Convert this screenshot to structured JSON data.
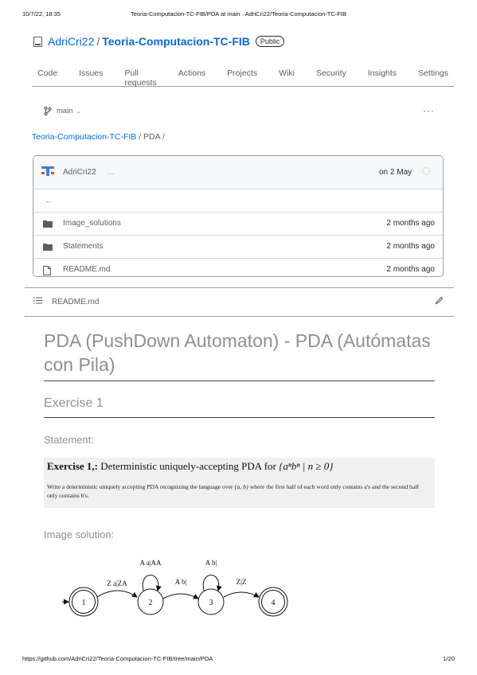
{
  "print": {
    "date": "10/7/22, 18:35",
    "title": "Teoria-Computacion-TC-FIB/PDA at main · AdriCri22/Teoria-Computacion-TC-FIB",
    "url": "https://github.com/AdriCri22/Teoria-Computacion-TC-FIB/tree/main/PDA",
    "page": "1/20"
  },
  "repo": {
    "owner": "AdriCri22",
    "separator": "/",
    "name": "Teoria-Computacion-TC-FIB",
    "visibility": "Public",
    "icon": "repo-icon"
  },
  "tabs": [
    {
      "label": "Code"
    },
    {
      "label": "Issues"
    },
    {
      "label": "Pull requests"
    },
    {
      "label": "Actions"
    },
    {
      "label": "Projects"
    },
    {
      "label": "Wiki"
    },
    {
      "label": "Security"
    },
    {
      "label": "Insights"
    },
    {
      "label": "Settings"
    }
  ],
  "branch": {
    "name": "main",
    "icon": "git-branch-icon",
    "more_icon": "kebab-icon"
  },
  "breadcrumb": {
    "repo_link": "Teoria-Computacion-TC-FIB",
    "rest": " / PDA /"
  },
  "commit": {
    "author": "AdriCri22",
    "ellipsis": "…",
    "date": "on 2 May"
  },
  "files": {
    "updir": "..",
    "rows": [
      {
        "name": "Image_solutions",
        "date": "2 months ago",
        "type": "folder"
      },
      {
        "name": "Statements",
        "date": "2 months ago",
        "type": "folder"
      },
      {
        "name": "README.md",
        "date": "2 months ago",
        "type": "file"
      }
    ]
  },
  "readme": {
    "label": "README.md",
    "icons": [
      "list-icon",
      "pencil-icon"
    ]
  },
  "content": {
    "h1": "PDA (PushDown Automaton) - PDA (Autómatas con Pila)",
    "h2": "Exercise 1",
    "statement_heading": "Statement:",
    "exercise": {
      "title_bold": "Exercise 1,:",
      "title_text": " Deterministic uniquely-accepting PDA for ",
      "title_math": "{aⁿbⁿ | n ≥ 0}",
      "body_1": "Write a deterministic uniquely accepting PDA recognizing the language over ",
      "body_math": "{a, b}",
      "body_2": " where the first half of each word only contains a's and the second half only contains b's."
    },
    "image_heading": "Image solution:",
    "diagram": {
      "states": [
        "1",
        "2",
        "3",
        "4"
      ],
      "edges": [
        "Z a|ZA",
        "A a|AA",
        "A b|",
        "A b|",
        "Z|Z"
      ]
    }
  },
  "colors": {
    "link": "#0969da",
    "muted": "#57606a",
    "heading": "#8b9196"
  }
}
